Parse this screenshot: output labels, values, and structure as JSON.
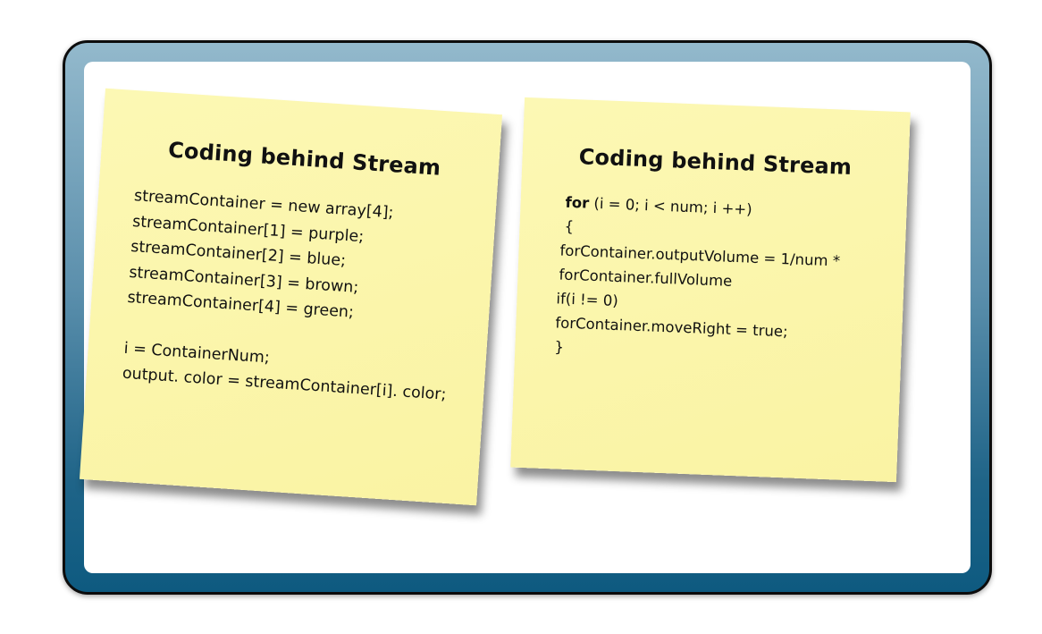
{
  "left_note": {
    "title": "Coding behind Stream",
    "lines": [
      "streamContainer = new array[4];",
      "streamContainer[1] = purple;",
      "streamContainer[2] = blue;",
      "streamContainer[3] = brown;",
      "streamContainer[4] = green;",
      "",
      "i = ContainerNum;",
      "output. color = streamContainer[i]. color;"
    ]
  },
  "right_note": {
    "title": "Coding behind Stream",
    "for_keyword": "for",
    "for_rest": " (i = 0; i < num; i ++)",
    "lines": [
      "{",
      "forContainer.outputVolume = 1/num *",
      "forContainer.fullVolume",
      "if(i != 0)",
      "forContainer.moveRight = true;",
      "}"
    ]
  },
  "colors": {
    "note_fill": "#fbf6aa",
    "frame_top": "#93b9cc",
    "frame_bottom": "#0e5a80"
  }
}
